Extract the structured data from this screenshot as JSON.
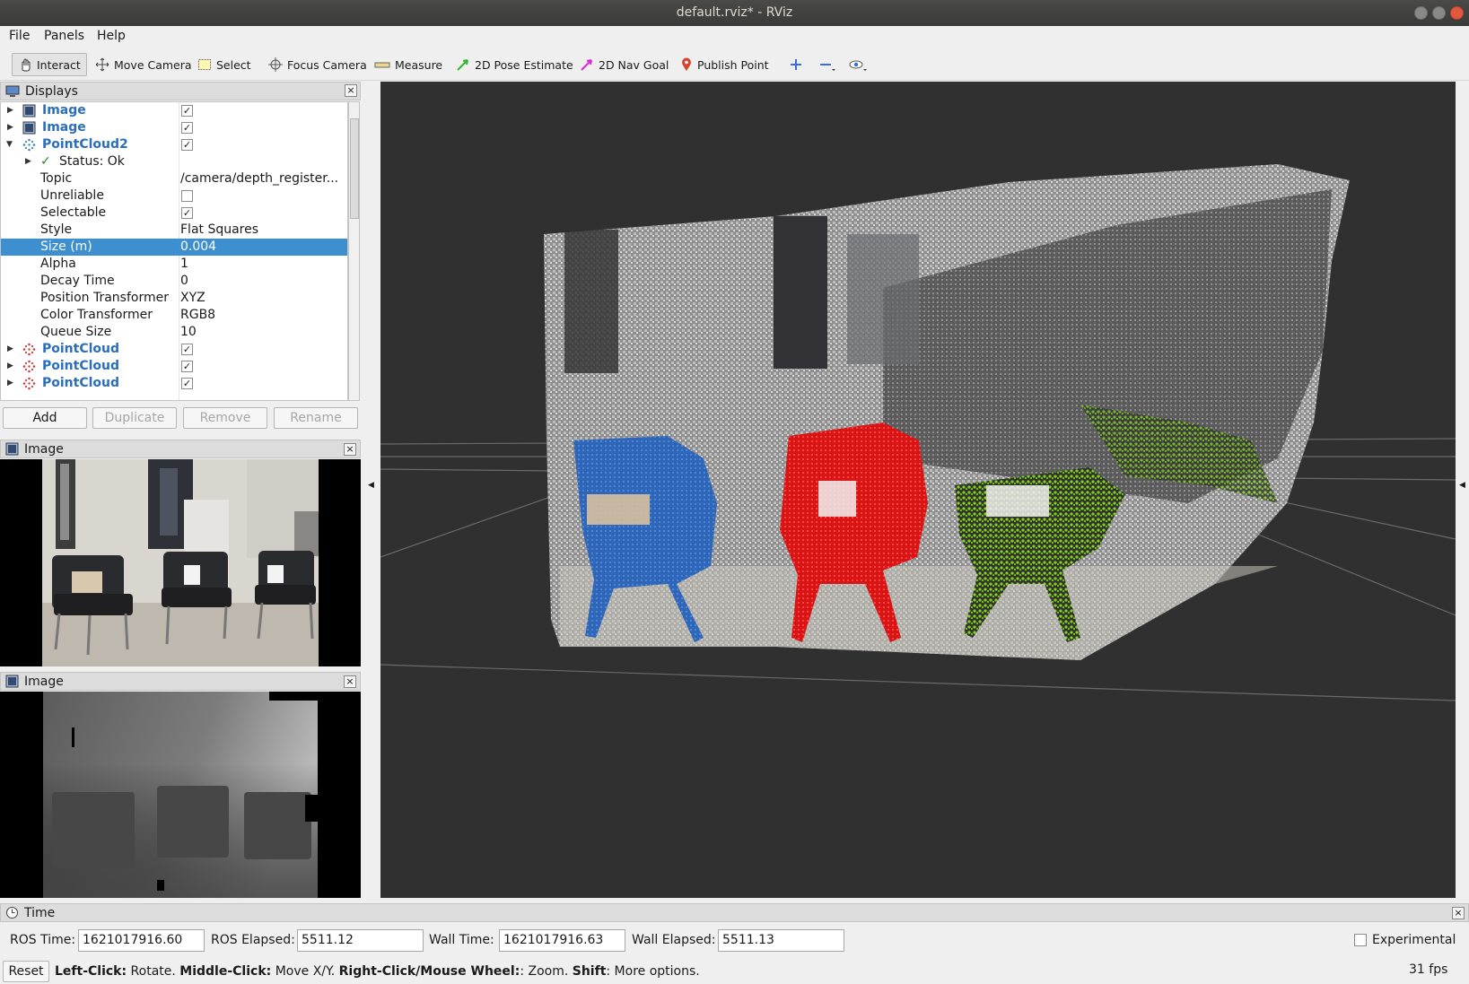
{
  "window": {
    "title": "default.rviz* - RViz"
  },
  "menu": [
    "File",
    "Panels",
    "Help"
  ],
  "toolbar": {
    "interact": "Interact",
    "move_camera": "Move Camera",
    "select": "Select",
    "focus_camera": "Focus Camera",
    "measure": "Measure",
    "pose_estimate": "2D Pose Estimate",
    "nav_goal": "2D Nav Goal",
    "publish_point": "Publish Point"
  },
  "displays": {
    "title": "Displays",
    "rows": [
      {
        "label": "Image",
        "checked": "✓"
      },
      {
        "label": "Image",
        "checked": "✓"
      },
      {
        "label": "PointCloud2",
        "checked": "✓"
      },
      {
        "label": "Status: Ok"
      },
      {
        "label": "Topic",
        "value": "/camera/depth_register..."
      },
      {
        "label": "Unreliable",
        "checked": ""
      },
      {
        "label": "Selectable",
        "checked": "✓"
      },
      {
        "label": "Style",
        "value": "Flat Squares"
      },
      {
        "label": "Size (m)",
        "value": "0.004"
      },
      {
        "label": "Alpha",
        "value": "1"
      },
      {
        "label": "Decay Time",
        "value": "0"
      },
      {
        "label": "Position Transformer",
        "value": "XYZ"
      },
      {
        "label": "Color Transformer",
        "value": "RGB8"
      },
      {
        "label": "Queue Size",
        "value": "10"
      },
      {
        "label": "PointCloud",
        "checked": "✓"
      },
      {
        "label": "PointCloud",
        "checked": "✓"
      },
      {
        "label": "PointCloud",
        "checked": "✓"
      }
    ],
    "buttons": {
      "add": "Add",
      "duplicate": "Duplicate",
      "remove": "Remove",
      "rename": "Rename"
    }
  },
  "image_panel_1": {
    "title": "Image"
  },
  "image_panel_2": {
    "title": "Image"
  },
  "time": {
    "title": "Time",
    "ros_time_label": "ROS Time:",
    "ros_time": "1621017916.60",
    "ros_elapsed_label": "ROS Elapsed:",
    "ros_elapsed": "5511.12",
    "wall_time_label": "Wall Time:",
    "wall_time": "1621017916.63",
    "wall_elapsed_label": "Wall Elapsed:",
    "wall_elapsed": "5511.13",
    "experimental": "Experimental",
    "reset": "Reset",
    "hint_b1": "Left-Click:",
    "hint_t1": " Rotate. ",
    "hint_b2": "Middle-Click:",
    "hint_t2": " Move X/Y. ",
    "hint_b3": "Right-Click/Mouse Wheel:",
    "hint_t3": ": Zoom. ",
    "hint_b4": "Shift",
    "hint_t4": ": More options.",
    "fps": "31 fps"
  },
  "colors": {
    "selection": "#3d8fd0",
    "viewport": "#303030",
    "cloud_blue": "#3a6fc0",
    "cloud_red": "#e02020",
    "cloud_green": "#7bd020"
  }
}
